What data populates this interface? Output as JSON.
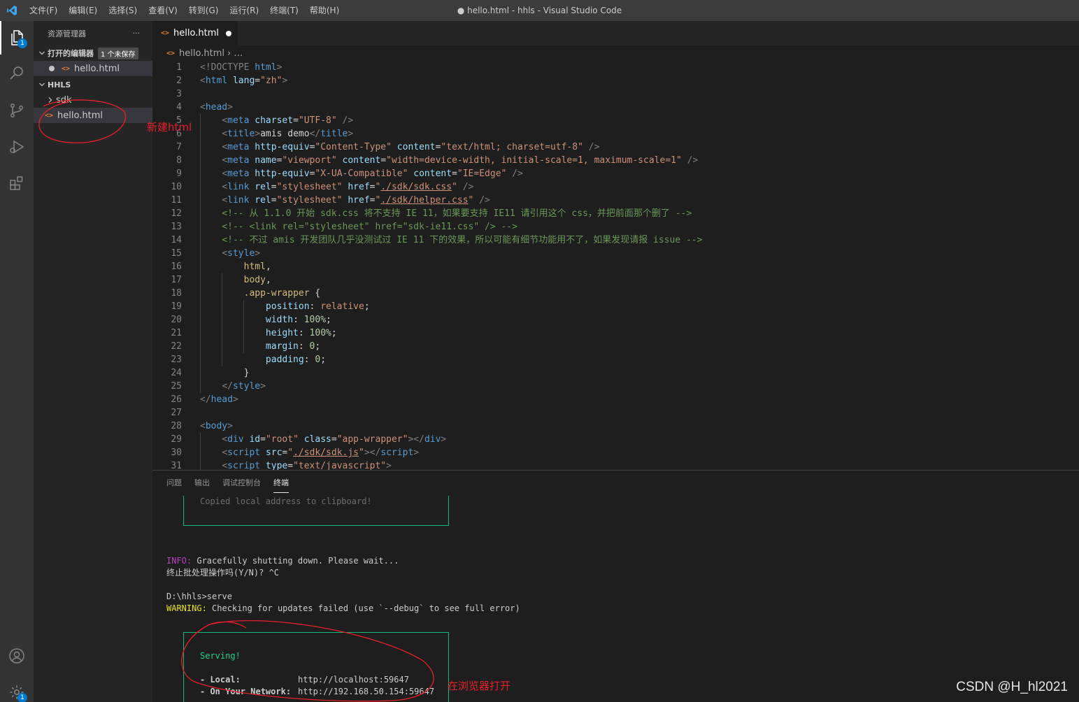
{
  "titlebar": {
    "menu": [
      "文件(F)",
      "编辑(E)",
      "选择(S)",
      "查看(V)",
      "转到(G)",
      "运行(R)",
      "终端(T)",
      "帮助(H)"
    ],
    "window_title": "● hello.html - hhls - Visual Studio Code"
  },
  "activitybar": {
    "explorer_badge": "1",
    "settings_badge": "1"
  },
  "sidebar": {
    "title": "资源管理器",
    "more": "···",
    "open_editors": {
      "label": "打开的编辑器",
      "unsaved": "1 个未保存",
      "file": "hello.html"
    },
    "workspace": {
      "label": "HHLS",
      "folder": "sdk",
      "file": "hello.html"
    }
  },
  "editor": {
    "tab_label": "hello.html",
    "breadcrumb_file": "hello.html",
    "breadcrumb_rest": "…",
    "lines": [
      [
        [
          "t-br",
          "<!DOCTYPE "
        ],
        [
          "t-tag",
          "html"
        ],
        [
          "t-br",
          ">"
        ]
      ],
      [
        [
          "t-br",
          "<"
        ],
        [
          "t-tag",
          "html "
        ],
        [
          "t-attr",
          "lang"
        ],
        [
          "t-txt",
          "="
        ],
        [
          "t-str",
          "\"zh\""
        ],
        [
          "t-br",
          ">"
        ]
      ],
      [],
      [
        [
          "t-br",
          "<"
        ],
        [
          "t-tag",
          "head"
        ],
        [
          "t-br",
          ">"
        ]
      ],
      [
        [
          "t-txt",
          "    "
        ],
        [
          "t-br",
          "<"
        ],
        [
          "t-tag",
          "meta "
        ],
        [
          "t-attr",
          "charset"
        ],
        [
          "t-txt",
          "="
        ],
        [
          "t-str",
          "\"UTF-8\""
        ],
        [
          "t-br",
          " />"
        ]
      ],
      [
        [
          "t-txt",
          "    "
        ],
        [
          "t-br",
          "<"
        ],
        [
          "t-tag",
          "title"
        ],
        [
          "t-br",
          ">"
        ],
        [
          "t-txt",
          "amis demo"
        ],
        [
          "t-br",
          "</"
        ],
        [
          "t-tag",
          "title"
        ],
        [
          "t-br",
          ">"
        ]
      ],
      [
        [
          "t-txt",
          "    "
        ],
        [
          "t-br",
          "<"
        ],
        [
          "t-tag",
          "meta "
        ],
        [
          "t-attr",
          "http-equiv"
        ],
        [
          "t-txt",
          "="
        ],
        [
          "t-str",
          "\"Content-Type\""
        ],
        [
          "t-txt",
          " "
        ],
        [
          "t-attr",
          "content"
        ],
        [
          "t-txt",
          "="
        ],
        [
          "t-str",
          "\"text/html; charset=utf-8\""
        ],
        [
          "t-br",
          " />"
        ]
      ],
      [
        [
          "t-txt",
          "    "
        ],
        [
          "t-br",
          "<"
        ],
        [
          "t-tag",
          "meta "
        ],
        [
          "t-attr",
          "name"
        ],
        [
          "t-txt",
          "="
        ],
        [
          "t-str",
          "\"viewport\""
        ],
        [
          "t-txt",
          " "
        ],
        [
          "t-attr",
          "content"
        ],
        [
          "t-txt",
          "="
        ],
        [
          "t-str",
          "\"width=device-width, initial-scale=1, maximum-scale=1\""
        ],
        [
          "t-br",
          " />"
        ]
      ],
      [
        [
          "t-txt",
          "    "
        ],
        [
          "t-br",
          "<"
        ],
        [
          "t-tag",
          "meta "
        ],
        [
          "t-attr",
          "http-equiv"
        ],
        [
          "t-txt",
          "="
        ],
        [
          "t-str",
          "\"X-UA-Compatible\""
        ],
        [
          "t-txt",
          " "
        ],
        [
          "t-attr",
          "content"
        ],
        [
          "t-txt",
          "="
        ],
        [
          "t-str",
          "\"IE=Edge\""
        ],
        [
          "t-br",
          " />"
        ]
      ],
      [
        [
          "t-txt",
          "    "
        ],
        [
          "t-br",
          "<"
        ],
        [
          "t-tag",
          "link "
        ],
        [
          "t-attr",
          "rel"
        ],
        [
          "t-txt",
          "="
        ],
        [
          "t-str",
          "\"stylesheet\""
        ],
        [
          "t-txt",
          " "
        ],
        [
          "t-attr",
          "href"
        ],
        [
          "t-txt",
          "="
        ],
        [
          "t-str",
          "\""
        ],
        [
          "t-str t-und",
          "./sdk/sdk.css"
        ],
        [
          "t-str",
          "\""
        ],
        [
          "t-br",
          " />"
        ]
      ],
      [
        [
          "t-txt",
          "    "
        ],
        [
          "t-br",
          "<"
        ],
        [
          "t-tag",
          "link "
        ],
        [
          "t-attr",
          "rel"
        ],
        [
          "t-txt",
          "="
        ],
        [
          "t-str",
          "\"stylesheet\""
        ],
        [
          "t-txt",
          " "
        ],
        [
          "t-attr",
          "href"
        ],
        [
          "t-txt",
          "="
        ],
        [
          "t-str",
          "\""
        ],
        [
          "t-str t-und",
          "./sdk/helper.css"
        ],
        [
          "t-str",
          "\""
        ],
        [
          "t-br",
          " />"
        ]
      ],
      [
        [
          "t-txt",
          "    "
        ],
        [
          "t-com",
          "<!-- 从 1.1.0 开始 sdk.css 将不支持 IE 11，如果要支持 IE11 请引用这个 css，并把前面那个删了 -->"
        ]
      ],
      [
        [
          "t-txt",
          "    "
        ],
        [
          "t-com",
          "<!-- <link rel=\"stylesheet\" href=\"sdk-ie11.css\" /> -->"
        ]
      ],
      [
        [
          "t-txt",
          "    "
        ],
        [
          "t-com",
          "<!-- 不过 amis 开发团队几乎没测试过 IE 11 下的效果，所以可能有细节功能用不了，如果发现请报 issue -->"
        ]
      ],
      [
        [
          "t-txt",
          "    "
        ],
        [
          "t-br",
          "<"
        ],
        [
          "t-tag",
          "style"
        ],
        [
          "t-br",
          ">"
        ]
      ],
      [
        [
          "t-txt",
          "        "
        ],
        [
          "t-sel",
          "html"
        ],
        [
          "t-txt",
          ","
        ]
      ],
      [
        [
          "t-txt",
          "        "
        ],
        [
          "t-sel",
          "body"
        ],
        [
          "t-txt",
          ","
        ]
      ],
      [
        [
          "t-txt",
          "        "
        ],
        [
          "t-sel",
          ".app-wrapper"
        ],
        [
          "t-txt",
          " {"
        ]
      ],
      [
        [
          "t-txt",
          "            "
        ],
        [
          "t-prop",
          "position"
        ],
        [
          "t-txt",
          ": "
        ],
        [
          "t-val",
          "relative"
        ],
        [
          "t-txt",
          ";"
        ]
      ],
      [
        [
          "t-txt",
          "            "
        ],
        [
          "t-prop",
          "width"
        ],
        [
          "t-txt",
          ": "
        ],
        [
          "t-num",
          "100%"
        ],
        [
          "t-txt",
          ";"
        ]
      ],
      [
        [
          "t-txt",
          "            "
        ],
        [
          "t-prop",
          "height"
        ],
        [
          "t-txt",
          ": "
        ],
        [
          "t-num",
          "100%"
        ],
        [
          "t-txt",
          ";"
        ]
      ],
      [
        [
          "t-txt",
          "            "
        ],
        [
          "t-prop",
          "margin"
        ],
        [
          "t-txt",
          ": "
        ],
        [
          "t-num",
          "0"
        ],
        [
          "t-txt",
          ";"
        ]
      ],
      [
        [
          "t-txt",
          "            "
        ],
        [
          "t-prop",
          "padding"
        ],
        [
          "t-txt",
          ": "
        ],
        [
          "t-num",
          "0"
        ],
        [
          "t-txt",
          ";"
        ]
      ],
      [
        [
          "t-txt",
          "        }"
        ]
      ],
      [
        [
          "t-txt",
          "    "
        ],
        [
          "t-br",
          "</"
        ],
        [
          "t-tag",
          "style"
        ],
        [
          "t-br",
          ">"
        ]
      ],
      [
        [
          "t-br",
          "</"
        ],
        [
          "t-tag",
          "head"
        ],
        [
          "t-br",
          ">"
        ]
      ],
      [],
      [
        [
          "t-br",
          "<"
        ],
        [
          "t-tag",
          "body"
        ],
        [
          "t-br",
          ">"
        ]
      ],
      [
        [
          "t-txt",
          "    "
        ],
        [
          "t-br",
          "<"
        ],
        [
          "t-tag",
          "div "
        ],
        [
          "t-attr",
          "id"
        ],
        [
          "t-txt",
          "="
        ],
        [
          "t-str",
          "\"root\""
        ],
        [
          "t-txt",
          " "
        ],
        [
          "t-attr",
          "class"
        ],
        [
          "t-txt",
          "="
        ],
        [
          "t-str",
          "\"app-wrapper\""
        ],
        [
          "t-br",
          "></"
        ],
        [
          "t-tag",
          "div"
        ],
        [
          "t-br",
          ">"
        ]
      ],
      [
        [
          "t-txt",
          "    "
        ],
        [
          "t-br",
          "<"
        ],
        [
          "t-tag",
          "script "
        ],
        [
          "t-attr",
          "src"
        ],
        [
          "t-txt",
          "="
        ],
        [
          "t-str",
          "\""
        ],
        [
          "t-str t-und",
          "./sdk/sdk.js"
        ],
        [
          "t-str",
          "\""
        ],
        [
          "t-br",
          "></"
        ],
        [
          "t-tag",
          "script"
        ],
        [
          "t-br",
          ">"
        ]
      ],
      [
        [
          "t-txt",
          "    "
        ],
        [
          "t-br",
          "<"
        ],
        [
          "t-tag",
          "script "
        ],
        [
          "t-attr",
          "type"
        ],
        [
          "t-txt",
          "="
        ],
        [
          "t-str",
          "\"text/javascript\""
        ],
        [
          "t-br",
          ">"
        ]
      ]
    ]
  },
  "panel": {
    "tabs": [
      "问题",
      "输出",
      "调试控制台",
      "终端"
    ],
    "terminal": {
      "copied": "Copied local address to clipboard!",
      "info_label": "INFO:",
      "info_text": " Gracefully shutting down. Please wait...",
      "terminate": "终止批处理操作吗(Y/N)? ^C",
      "prompt": "D:\\hhls>serve",
      "warn_label": "WARNING:",
      "warn_text": " Checking for updates failed (use `--debug` to see full error)",
      "serving": "Serving!",
      "local_label": "- Local:",
      "local_url": "http://localhost:59647",
      "network_label": "- On Your Network:",
      "network_url": "http://192.168.50.154:59647"
    }
  },
  "annotations": {
    "new_html": "新建html",
    "open_browser": "在浏览器打开"
  },
  "watermark": "CSDN @H_hl2021"
}
